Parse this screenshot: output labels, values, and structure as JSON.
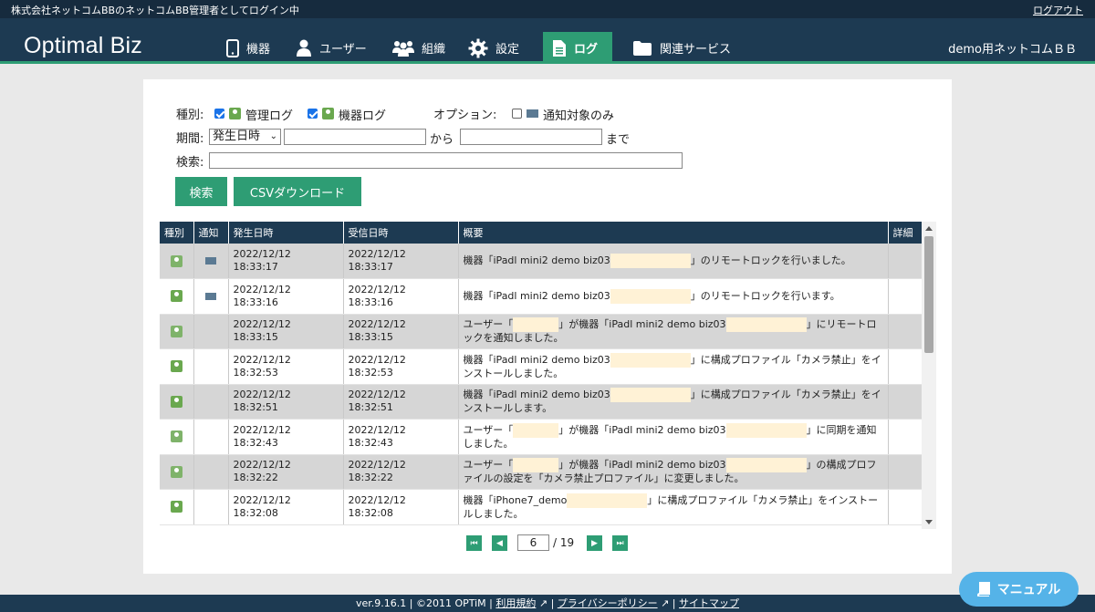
{
  "topbar": {
    "login_status": "株式会社ネットコムBBのネットコムBB管理者としてログイン中",
    "logout": "ログアウト"
  },
  "header": {
    "logo": "Optimal Biz",
    "nav": [
      "機器",
      "ユーザー",
      "組織",
      "設定",
      "ログ",
      "関連サービス"
    ],
    "active_nav": "ログ",
    "account": "demo用ネットコムＢＢ"
  },
  "filters": {
    "type_label": "種別:",
    "admin_log": "管理ログ",
    "device_log": "機器ログ",
    "option_label": "オプション:",
    "notify_only": "通知対象のみ",
    "period_label": "期間:",
    "period_select": "発生日時",
    "from": "から",
    "to": "まで",
    "search_label": "検索:",
    "search_button": "検索",
    "csv_button": "CSVダウンロード"
  },
  "table": {
    "headers": [
      "種別",
      "通知",
      "発生日時",
      "受信日時",
      "概要",
      "詳細"
    ],
    "rows": [
      {
        "type": "admin",
        "notify": true,
        "occurred": [
          "2022/12/12",
          "18:33:17"
        ],
        "received": [
          "2022/12/12",
          "18:33:17"
        ],
        "summary_a": "機器「iPadl mini2 demo biz03",
        "summary_b": "」のリモートロックを行いました。",
        "summary_c": "",
        "gray": true
      },
      {
        "type": "device",
        "notify": true,
        "occurred": [
          "2022/12/12",
          "18:33:16"
        ],
        "received": [
          "2022/12/12",
          "18:33:16"
        ],
        "summary_a": "機器「iPadl mini2 demo biz03",
        "summary_b": "」のリモートロックを行います。",
        "summary_c": "",
        "gray": false
      },
      {
        "type": "admin",
        "notify": false,
        "occurred": [
          "2022/12/12",
          "18:33:15"
        ],
        "received": [
          "2022/12/12",
          "18:33:15"
        ],
        "summary_a": "ユーザー「",
        "summary_b": "」が機器「iPadl mini2 demo biz03",
        "summary_c": "」にリモートロックを通知しました。",
        "gray": true
      },
      {
        "type": "device",
        "notify": false,
        "occurred": [
          "2022/12/12",
          "18:32:53"
        ],
        "received": [
          "2022/12/12",
          "18:32:53"
        ],
        "summary_a": "機器「iPadl mini2 demo biz03",
        "summary_b": "」に構成プロファイル「カメラ禁止」をインストールしました。",
        "summary_c": "",
        "gray": false
      },
      {
        "type": "device",
        "notify": false,
        "occurred": [
          "2022/12/12",
          "18:32:51"
        ],
        "received": [
          "2022/12/12",
          "18:32:51"
        ],
        "summary_a": "機器「iPadl mini2 demo biz03",
        "summary_b": "」に構成プロファイル「カメラ禁止」をインストールします。",
        "summary_c": "",
        "gray": true
      },
      {
        "type": "admin",
        "notify": false,
        "occurred": [
          "2022/12/12",
          "18:32:43"
        ],
        "received": [
          "2022/12/12",
          "18:32:43"
        ],
        "summary_a": "ユーザー「",
        "summary_b": "」が機器「iPadl mini2 demo biz03",
        "summary_c": "」に同期を通知しました。",
        "gray": false
      },
      {
        "type": "admin",
        "notify": false,
        "occurred": [
          "2022/12/12",
          "18:32:22"
        ],
        "received": [
          "2022/12/12",
          "18:32:22"
        ],
        "summary_a": "ユーザー「",
        "summary_b": "」が機器「iPadl mini2 demo biz03",
        "summary_c": "」の構成プロファイルの設定を「カメラ禁止プロファイル」に変更しました。",
        "gray": true
      },
      {
        "type": "device",
        "notify": false,
        "occurred": [
          "2022/12/12",
          "18:32:08"
        ],
        "received": [
          "2022/12/12",
          "18:32:08"
        ],
        "summary_a": "機器「iPhone7_demo",
        "summary_b": "」に構成プロファイル「カメラ禁止」をインストールしました。",
        "summary_c": "",
        "gray": false
      }
    ]
  },
  "pager": {
    "current": "6",
    "total": "/ 19"
  },
  "footer": {
    "version": "ver.9.16.1 | ©2011 OPTiM |",
    "terms": "利用規約",
    "privacy": "プライバシーポリシー",
    "sitemap": "サイトマップ"
  },
  "manual": "マニュアル"
}
